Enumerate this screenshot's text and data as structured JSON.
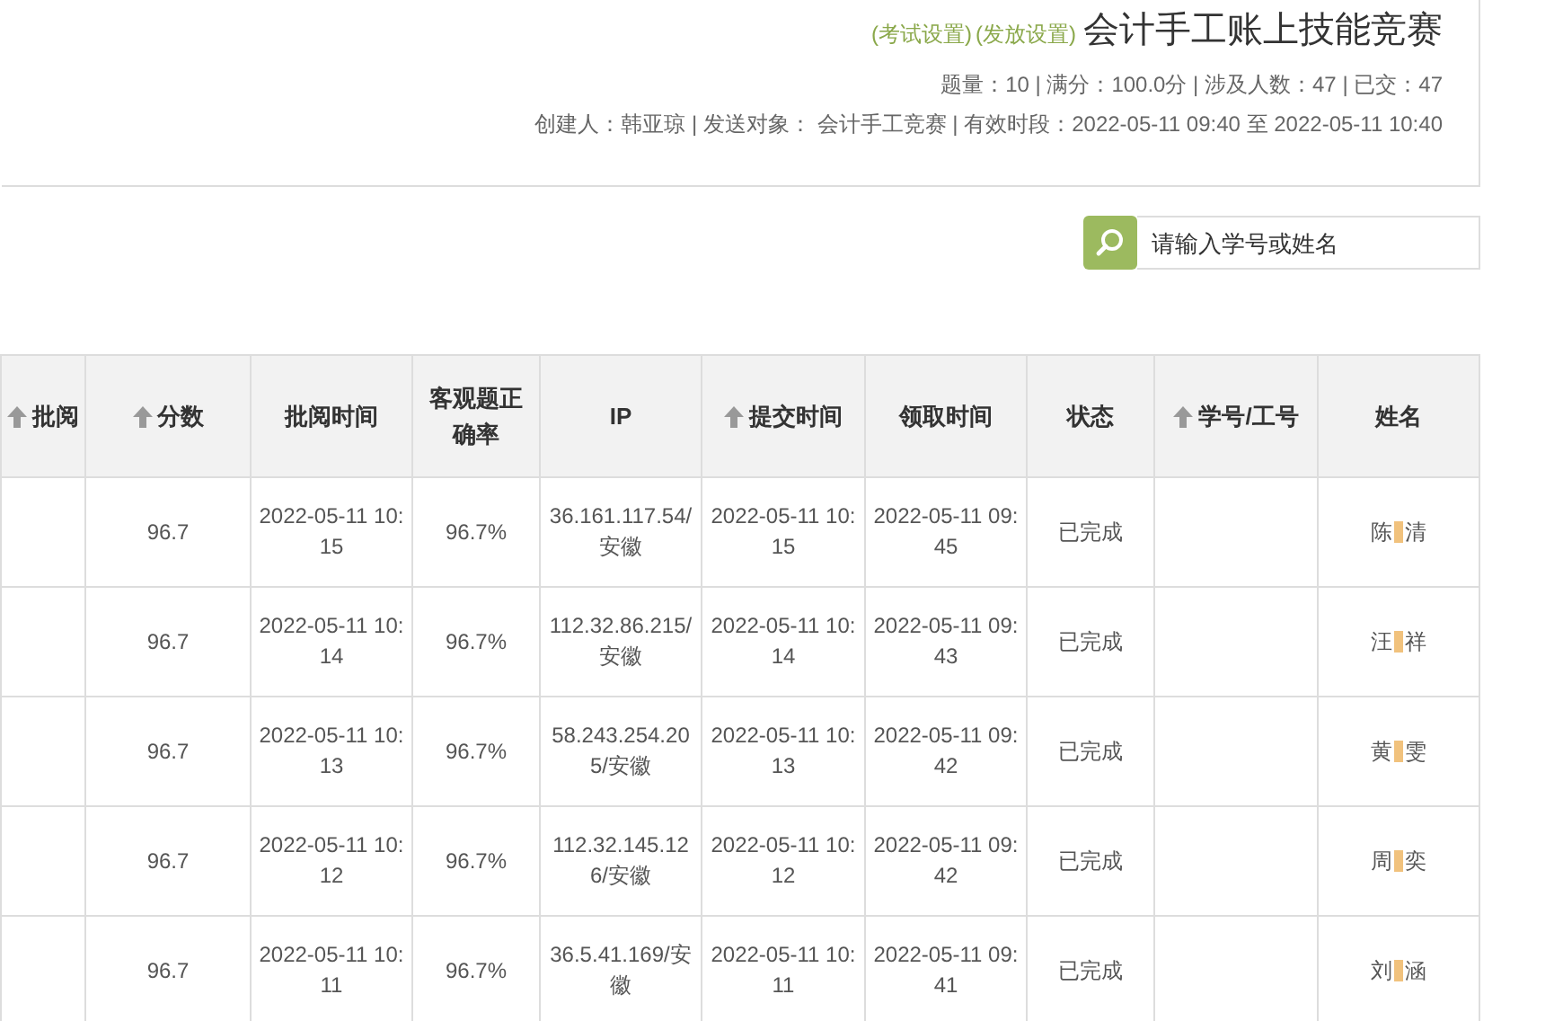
{
  "header": {
    "links": [
      "(考试设置)",
      "(发放设置)"
    ],
    "title": "会计手工账上技能竞赛",
    "stats": "题量：10 | 满分：100.0分 | 涉及人数：47 | 已交：47",
    "info": "创建人：韩亚琼 | 发送对象： 会计手工竞赛 | 有效时段：2022-05-11 09:40 至 2022-05-11 10:40"
  },
  "search": {
    "placeholder": "请输入学号或姓名"
  },
  "table": {
    "columns": [
      {
        "label": "批阅",
        "sortable": true
      },
      {
        "label": "分数",
        "sortable": true
      },
      {
        "label": "批阅时间",
        "sortable": false
      },
      {
        "label": "客观题正确率",
        "sortable": false
      },
      {
        "label": "IP",
        "sortable": false
      },
      {
        "label": "提交时间",
        "sortable": true
      },
      {
        "label": "领取时间",
        "sortable": false
      },
      {
        "label": "状态",
        "sortable": false
      },
      {
        "label": "学号/工号",
        "sortable": true
      },
      {
        "label": "姓名",
        "sortable": false
      }
    ],
    "rows": [
      {
        "score": "96.7",
        "reviewed": "2022-05-11 10:15",
        "accuracy": "96.7%",
        "ip": "36.161.117.54/安徽",
        "submitted": "2022-05-11 10:15",
        "received": "2022-05-11 09:45",
        "status": "已完成",
        "name_start": "陈",
        "name_end": "清"
      },
      {
        "score": "96.7",
        "reviewed": "2022-05-11 10:14",
        "accuracy": "96.7%",
        "ip": "112.32.86.215/安徽",
        "submitted": "2022-05-11 10:14",
        "received": "2022-05-11 09:43",
        "status": "已完成",
        "name_start": "汪",
        "name_end": "祥"
      },
      {
        "score": "96.7",
        "reviewed": "2022-05-11 10:13",
        "accuracy": "96.7%",
        "ip": "58.243.254.205/安徽",
        "submitted": "2022-05-11 10:13",
        "received": "2022-05-11 09:42",
        "status": "已完成",
        "name_start": "黄",
        "name_end": "雯"
      },
      {
        "score": "96.7",
        "reviewed": "2022-05-11 10:12",
        "accuracy": "96.7%",
        "ip": "112.32.145.126/安徽",
        "submitted": "2022-05-11 10:12",
        "received": "2022-05-11 09:42",
        "status": "已完成",
        "name_start": "周",
        "name_end": "奕"
      },
      {
        "score": "96.7",
        "reviewed": "2022-05-11 10:11",
        "accuracy": "96.7%",
        "ip": "36.5.41.169/安徽",
        "submitted": "2022-05-11 10:11",
        "received": "2022-05-11 09:41",
        "status": "已完成",
        "name_start": "刘",
        "name_end": "涵"
      }
    ]
  }
}
